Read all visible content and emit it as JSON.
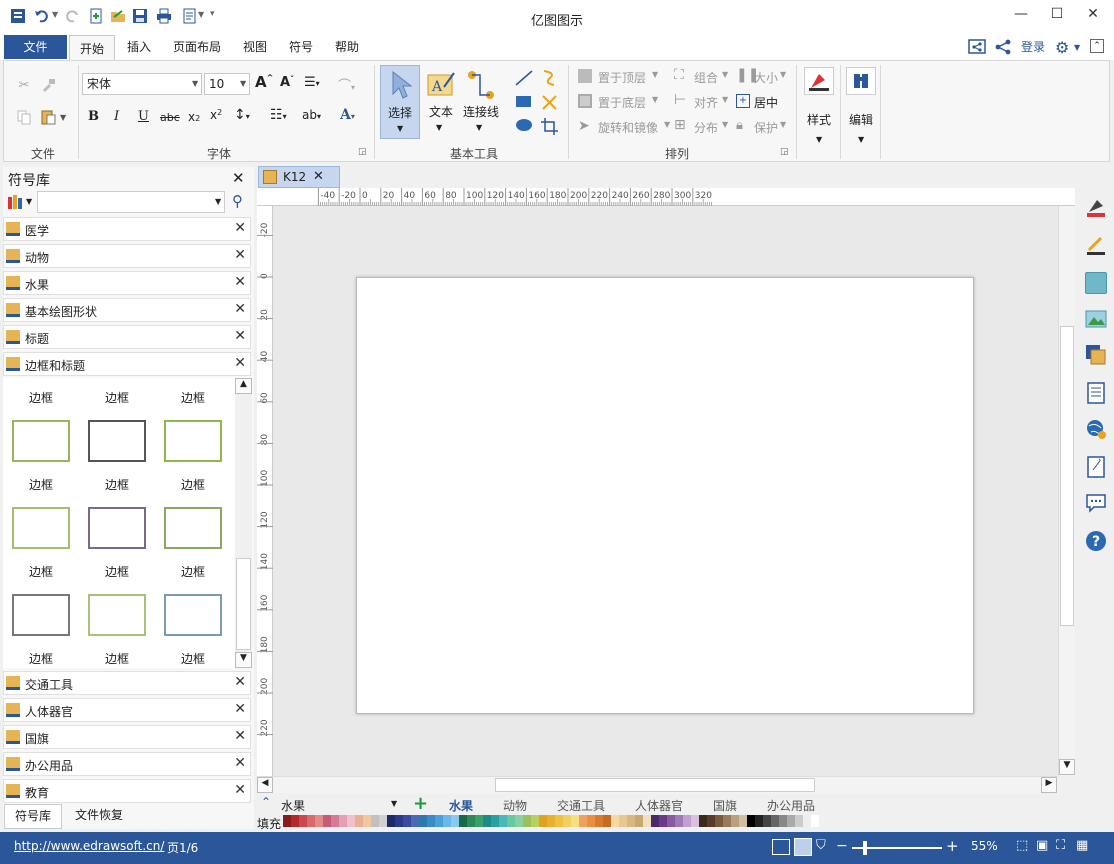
{
  "app": {
    "title": "亿图图示"
  },
  "menubar": {
    "file": "文件",
    "tabs": [
      "开始",
      "插入",
      "页面布局",
      "视图",
      "符号",
      "帮助"
    ],
    "login": "登录"
  },
  "ribbon": {
    "groups": {
      "file": "文件",
      "font": "字体",
      "tools": "基本工具",
      "arrange": "排列"
    },
    "font_name": "宋体",
    "font_size": "10",
    "tools": {
      "select": "选择",
      "text": "文本",
      "connector": "连接线"
    },
    "arrange": {
      "bring_front": "置于顶层",
      "send_back": "置于底层",
      "rotate_mirror": "旋转和镜像",
      "group": "组合",
      "align": "对齐",
      "distribute": "分布",
      "size": "大小",
      "center": "居中",
      "protect": "保护"
    },
    "style": "样式",
    "edit": "编辑"
  },
  "library": {
    "title": "符号库",
    "categories_top": [
      "医学",
      "动物",
      "水果",
      "基本绘图形状",
      "标题",
      "边框和标题"
    ],
    "thumb_label": "边框",
    "categories_bottom": [
      "交通工具",
      "人体器官",
      "国旗",
      "办公用品",
      "教育"
    ],
    "tabs": [
      "符号库",
      "文件恢复"
    ]
  },
  "document": {
    "tab": "K12"
  },
  "ruler": {
    "h": [
      "-40",
      "-20",
      "0",
      "20",
      "40",
      "60",
      "80",
      "100",
      "120",
      "140",
      "160",
      "180",
      "200",
      "220",
      "240",
      "260",
      "280",
      "300",
      "320"
    ],
    "v": [
      "-20",
      "0",
      "20",
      "40",
      "60",
      "80",
      "100",
      "120",
      "140",
      "160",
      "180",
      "200",
      "220"
    ]
  },
  "bottom_tabs": {
    "library_select": "水果",
    "tabs": [
      "水果",
      "动物",
      "交通工具",
      "人体器官",
      "国旗",
      "办公用品"
    ],
    "fill_label": "填充"
  },
  "status": {
    "url": "http://www.edrawsoft.cn/",
    "page": "页1/6",
    "zoom": "55%"
  }
}
